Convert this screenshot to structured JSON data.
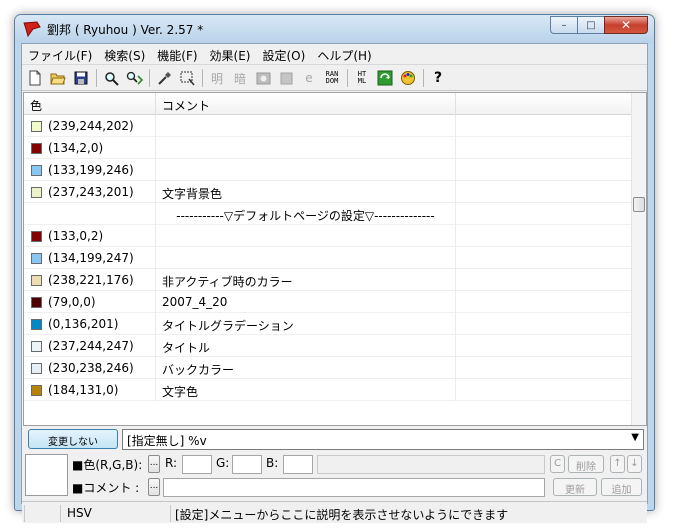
{
  "window": {
    "title": "劉邦 ( Ryuhou ) Ver. 2.57 *",
    "minimize": "–",
    "maximize": "□",
    "close": "✕"
  },
  "menu": [
    "ファイル(F)",
    "検索(S)",
    "機能(F)",
    "効果(E)",
    "設定(O)",
    "ヘルプ(H)"
  ],
  "toolbar": {
    "random_label": "RAN DOM",
    "html_label": "HT ML",
    "help_label": "?",
    "bright_label": "明",
    "dark_label": "暗",
    "e_label": "e"
  },
  "list": {
    "columns": [
      "色",
      "コメント",
      ""
    ],
    "rows": [
      {
        "color": "#effcca",
        "rgb": "(239,244,202)",
        "comment": ""
      },
      {
        "color": "#860200",
        "rgb": "(134,2,0)",
        "comment": ""
      },
      {
        "color": "#85c7f6",
        "rgb": "(133,199,246)",
        "comment": ""
      },
      {
        "color": "#edf3c9",
        "rgb": "(237,243,201)",
        "comment": "文字背景色"
      },
      {
        "color": "",
        "rgb": "",
        "comment": "-----------▽デフォルトページの設定▽--------------"
      },
      {
        "color": "#850002",
        "rgb": "(133,0,2)",
        "comment": ""
      },
      {
        "color": "#86c7f7",
        "rgb": "(134,199,247)",
        "comment": ""
      },
      {
        "color": "#eeddb0",
        "rgb": "(238,221,176)",
        "comment": "非アクティブ時のカラー"
      },
      {
        "color": "#4f0000",
        "rgb": "(79,0,0)",
        "comment": "2007_4_20"
      },
      {
        "color": "#0088c9",
        "rgb": "(0,136,201)",
        "comment": "タイトルグラデーション"
      },
      {
        "color": "#edf4f7",
        "rgb": "(237,244,247)",
        "comment": "タイトル"
      },
      {
        "color": "#e6eef6",
        "rgb": "(230,238,246)",
        "comment": "バックカラー"
      },
      {
        "color": "#b88300",
        "rgb": "(184,131,0)",
        "comment": "文字色"
      }
    ]
  },
  "controls": {
    "no_change_button": "変更しない",
    "format_select_value": "[指定無し] %v",
    "color_label": "■色(R,G,B):",
    "dots_button": "...",
    "r_label": "R:",
    "g_label": "G:",
    "b_label": "B:",
    "c_button": "C",
    "delete_button": "削除",
    "up_button": "↑",
    "down_button": "↓",
    "comment_label": "■コメント :",
    "update_button": "更新",
    "add_button": "追加"
  },
  "status": {
    "mode": "HSV",
    "message": "[設定]メニューからここに説明を表示させないようにできます"
  }
}
